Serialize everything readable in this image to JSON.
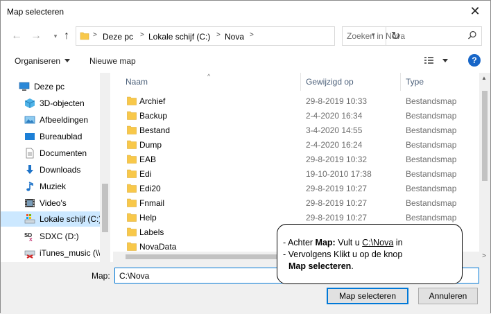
{
  "window": {
    "title": "Map selecteren"
  },
  "nav": {
    "breadcrumb": [
      "Deze pc",
      "Lokale schijf (C:)",
      "Nova"
    ],
    "search_placeholder": "Zoeken in Nova"
  },
  "toolbar": {
    "organize": "Organiseren",
    "new_folder": "Nieuwe map"
  },
  "sidebar": {
    "items": [
      {
        "label": "Deze pc",
        "icon": "pc-icon"
      },
      {
        "label": "3D-objecten",
        "icon": "cube-icon"
      },
      {
        "label": "Afbeeldingen",
        "icon": "pictures-icon"
      },
      {
        "label": "Bureaublad",
        "icon": "desktop-icon"
      },
      {
        "label": "Documenten",
        "icon": "document-icon"
      },
      {
        "label": "Downloads",
        "icon": "download-icon"
      },
      {
        "label": "Muziek",
        "icon": "music-icon"
      },
      {
        "label": "Video's",
        "icon": "video-icon"
      },
      {
        "label": "Lokale schijf (C:)",
        "icon": "drive-icon",
        "selected": true
      },
      {
        "label": "SDXC (D:)",
        "icon": "sd-card-icon"
      },
      {
        "label": "iTunes_music (\\\\",
        "icon": "network-drive-icon"
      }
    ]
  },
  "columns": {
    "name": "Naam",
    "date": "Gewijzigd op",
    "type": "Type"
  },
  "files": [
    {
      "name": "Archief",
      "date": "29-8-2019 10:33",
      "type": "Bestandsmap"
    },
    {
      "name": "Backup",
      "date": "2-4-2020 16:34",
      "type": "Bestandsmap"
    },
    {
      "name": "Bestand",
      "date": "3-4-2020 14:55",
      "type": "Bestandsmap"
    },
    {
      "name": "Dump",
      "date": "2-4-2020 16:24",
      "type": "Bestandsmap"
    },
    {
      "name": "EAB",
      "date": "29-8-2019 10:32",
      "type": "Bestandsmap"
    },
    {
      "name": "Edi",
      "date": "19-10-2010 17:38",
      "type": "Bestandsmap"
    },
    {
      "name": "Edi20",
      "date": "29-8-2019 10:27",
      "type": "Bestandsmap"
    },
    {
      "name": "Fnmail",
      "date": "29-8-2019 10:27",
      "type": "Bestandsmap"
    },
    {
      "name": "Help",
      "date": "29-8-2019 10:27",
      "type": "Bestandsmap"
    },
    {
      "name": "Labels",
      "date": "",
      "type": ""
    },
    {
      "name": "NovaData",
      "date": "",
      "type": ""
    }
  ],
  "footer": {
    "map_label": "Map:",
    "map_value": "C:\\Nova",
    "select_button": "Map selecteren",
    "cancel_button": "Annuleren"
  },
  "callout": {
    "line1_prefix": "- Achter ",
    "line1_bold": "Map:",
    "line1_mid": " Vult u ",
    "line1_link": "C:\\Nova",
    "line1_suffix": " in",
    "line2": "- Vervolgens Klikt u op de knop",
    "line3_bold": "Map selecteren",
    "line3_suffix": "."
  },
  "colors": {
    "accent": "#0078d7",
    "selection": "#cce8ff",
    "folder": "#f8c84a",
    "help": "#1766c8"
  }
}
